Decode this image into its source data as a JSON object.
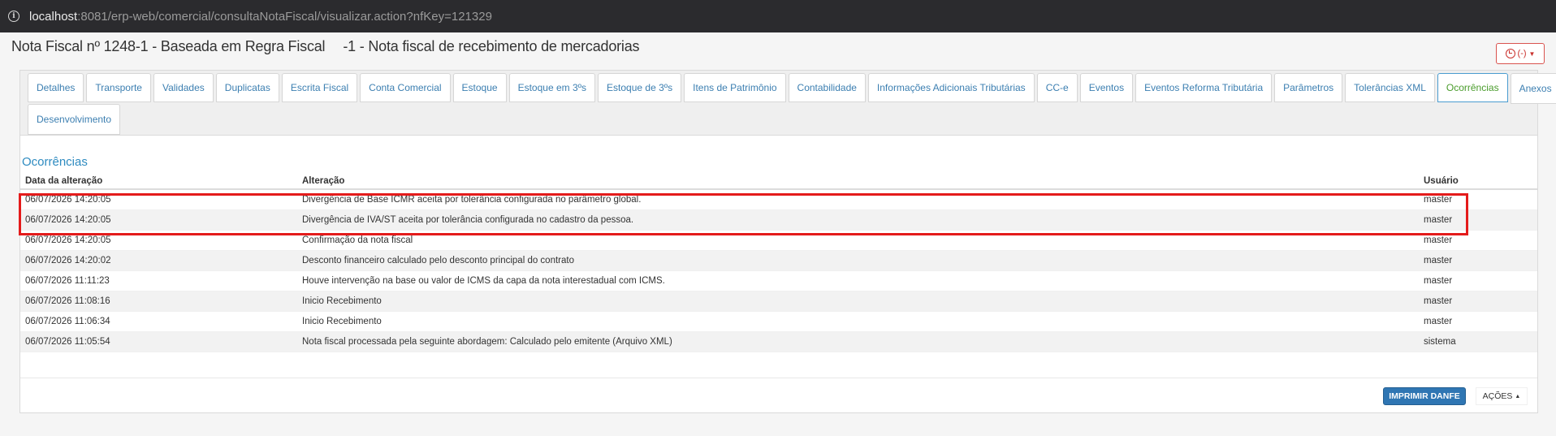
{
  "browser": {
    "url_host": "localhost",
    "url_rest": ":8081/erp-web/comercial/consultaNotaFiscal/visualizar.action?nfKey=121329"
  },
  "header": {
    "title_part1": "Nota Fiscal nº 1248-1 - Baseada em Regra Fiscal",
    "title_part2": "-1 - Nota fiscal de recebimento de mercadorias",
    "status_label": "(-)"
  },
  "tabs_row1": [
    {
      "label": "Detalhes"
    },
    {
      "label": "Transporte"
    },
    {
      "label": "Validades"
    },
    {
      "label": "Duplicatas"
    },
    {
      "label": "Escrita Fiscal"
    },
    {
      "label": "Conta Comercial"
    },
    {
      "label": "Estoque"
    },
    {
      "label": "Estoque em 3ºs"
    },
    {
      "label": "Estoque de 3ºs"
    },
    {
      "label": "Itens de Patrimônio"
    },
    {
      "label": "Contabilidade"
    },
    {
      "label": "Informações Adicionais Tributárias"
    },
    {
      "label": "CC-e"
    },
    {
      "label": "Eventos"
    },
    {
      "label": "Eventos Reforma Tributária"
    },
    {
      "label": "Parâmetros"
    },
    {
      "label": "Tolerâncias XML"
    },
    {
      "label": "Ocorrências"
    },
    {
      "label": "Anexos"
    }
  ],
  "tabs_row2": [
    {
      "label": "Desenvolvimento"
    }
  ],
  "section": {
    "title": "Ocorrências",
    "columns": [
      "Data da alteração",
      "Alteração",
      "Usuário"
    ],
    "rows": [
      {
        "date": "06/07/2026 14:20:05",
        "change": "Divergência de Base ICMR aceita por tolerância configurada no parâmetro global.",
        "user": "master"
      },
      {
        "date": "06/07/2026 14:20:05",
        "change": "Divergência de IVA/ST aceita por tolerância configurada no cadastro da pessoa.",
        "user": "master"
      },
      {
        "date": "06/07/2026 14:20:05",
        "change": "Confirmação da nota fiscal",
        "user": "master"
      },
      {
        "date": "06/07/2026 14:20:02",
        "change": "Desconto financeiro calculado pelo desconto principal do contrato",
        "user": "master"
      },
      {
        "date": "06/07/2026 11:11:23",
        "change": "Houve intervenção na base ou valor de ICMS da capa da nota interestadual com ICMS.",
        "user": "master"
      },
      {
        "date": "06/07/2026 11:08:16",
        "change": "Inicio Recebimento",
        "user": "master"
      },
      {
        "date": "06/07/2026 11:06:34",
        "change": "Inicio Recebimento",
        "user": "master"
      },
      {
        "date": "06/07/2026 11:05:54",
        "change": "Nota fiscal processada pela seguinte abordagem: Calculado pelo emitente (Arquivo XML)",
        "user": "sistema"
      }
    ]
  },
  "footer": {
    "print_label": "IMPRIMIR DANFE",
    "actions_label": "AÇÕES"
  },
  "colors": {
    "accent": "#2e8bc0",
    "active_tab": "#4a9c2c",
    "highlight": "#e41b1b",
    "primary_button": "#2f76b3"
  }
}
